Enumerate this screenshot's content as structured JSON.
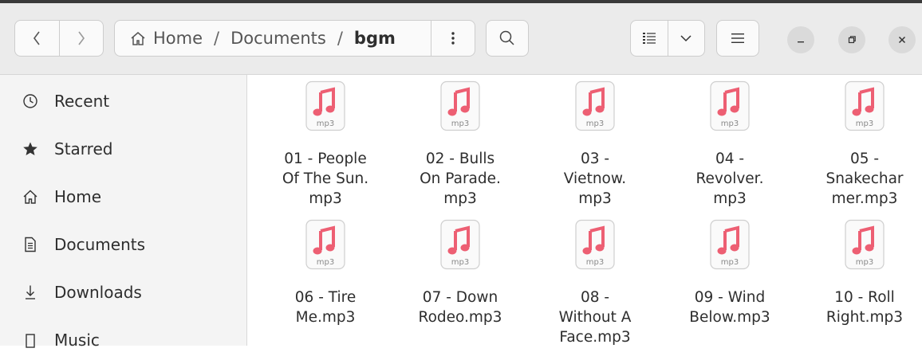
{
  "window": {
    "path": [
      "Home",
      "Documents",
      "bgm"
    ],
    "path_separator": "/"
  },
  "icons": {
    "back": "chevron-left-icon",
    "forward": "chevron-right-icon",
    "home": "home-icon",
    "path_menu": "vertical-dots-icon",
    "search": "search-icon",
    "view_list": "list-view-icon",
    "view_dropdown": "chevron-down-icon",
    "menu": "hamburger-icon",
    "minimize": "minimize-icon",
    "maximize": "maximize-icon",
    "close": "close-icon",
    "file_type": "audio-file-icon"
  },
  "colors": {
    "accent_music": "#ed5f73",
    "header": "#ebebeb",
    "sidebar": "#f4f4f4"
  },
  "sidebar": {
    "items": [
      {
        "label": "Recent",
        "icon": "clock-icon"
      },
      {
        "label": "Starred",
        "icon": "star-icon"
      },
      {
        "label": "Home",
        "icon": "home-icon"
      },
      {
        "label": "Documents",
        "icon": "document-icon"
      },
      {
        "label": "Downloads",
        "icon": "download-icon"
      },
      {
        "label": "Music",
        "icon": "music-icon"
      }
    ]
  },
  "files": [
    {
      "name_lines": [
        "01 - People",
        "Of The Sun.",
        "mp3"
      ],
      "ext": "mp3"
    },
    {
      "name_lines": [
        "02 - Bulls",
        "On Parade.",
        "mp3"
      ],
      "ext": "mp3"
    },
    {
      "name_lines": [
        "03 -",
        "Vietnow.",
        "mp3"
      ],
      "ext": "mp3"
    },
    {
      "name_lines": [
        "04 -",
        "Revolver.",
        "mp3"
      ],
      "ext": "mp3"
    },
    {
      "name_lines": [
        "05 -",
        "Snakechar",
        "mer.mp3"
      ],
      "ext": "mp3"
    },
    {
      "name_lines": [
        "06 - Tire",
        "Me.mp3"
      ],
      "ext": "mp3"
    },
    {
      "name_lines": [
        "07 - Down",
        "Rodeo.mp3"
      ],
      "ext": "mp3"
    },
    {
      "name_lines": [
        "08 -",
        "Without A",
        "Face.mp3"
      ],
      "ext": "mp3"
    },
    {
      "name_lines": [
        "09 - Wind",
        "Below.mp3"
      ],
      "ext": "mp3"
    },
    {
      "name_lines": [
        "10 - Roll",
        "Right.mp3"
      ],
      "ext": "mp3"
    }
  ]
}
